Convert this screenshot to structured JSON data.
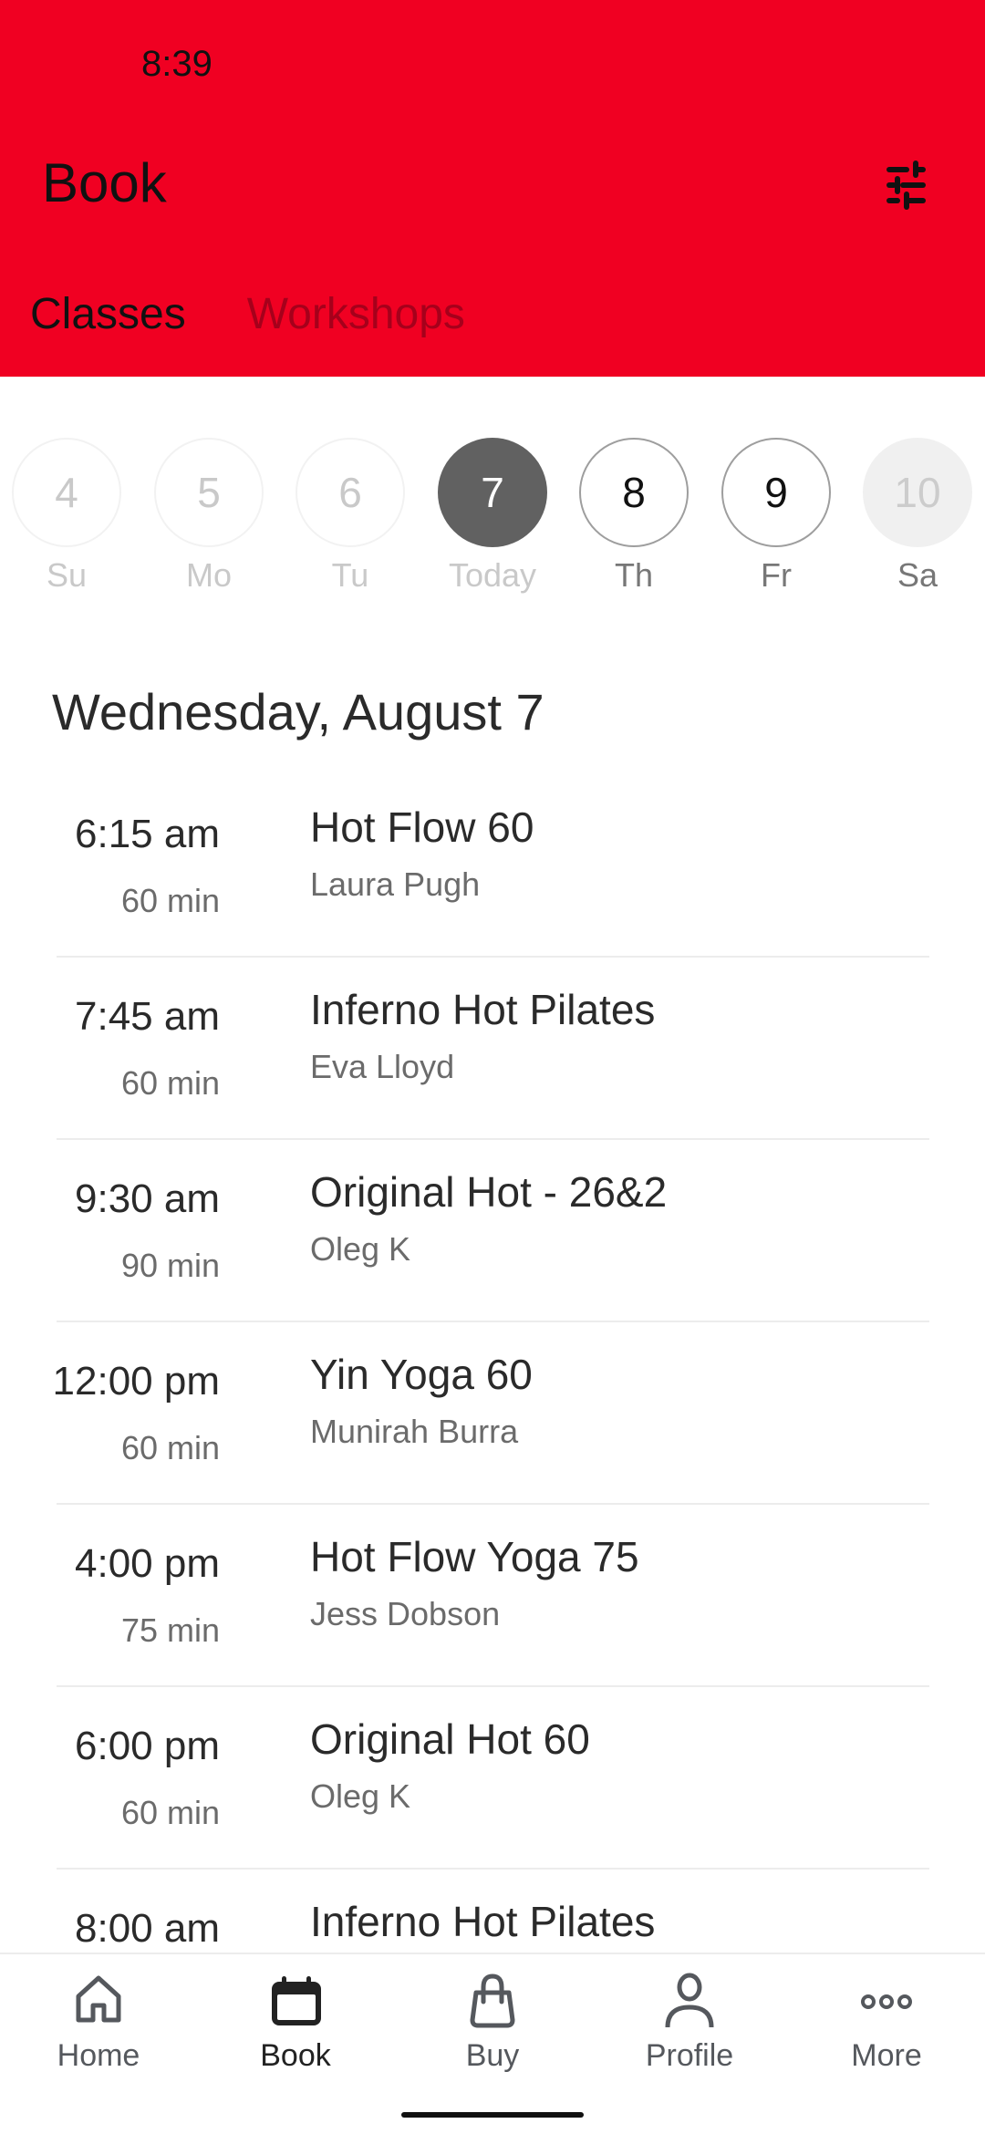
{
  "status_bar": {
    "time": "8:39"
  },
  "header": {
    "title": "Book",
    "filter_icon": "sliders-icon",
    "tabs": [
      {
        "label": "Classes",
        "active": true
      },
      {
        "label": "Workshops",
        "active": false
      }
    ]
  },
  "colors": {
    "brand": "#f00022",
    "inactive_tab": "#a6001b",
    "selected_day": "#616161"
  },
  "day_picker": {
    "days": [
      {
        "number": "4",
        "label": "Su",
        "state": "past"
      },
      {
        "number": "5",
        "label": "Mo",
        "state": "past"
      },
      {
        "number": "6",
        "label": "Tu",
        "state": "past"
      },
      {
        "number": "7",
        "label": "Today",
        "state": "selected"
      },
      {
        "number": "8",
        "label": "Th",
        "state": "available"
      },
      {
        "number": "9",
        "label": "Fr",
        "state": "available"
      },
      {
        "number": "10",
        "label": "Sa",
        "state": "unavailable"
      }
    ]
  },
  "schedule": {
    "date_heading": "Wednesday, August 7",
    "classes": [
      {
        "time": "6:15 am",
        "duration": "60 min",
        "name": "Hot Flow 60",
        "instructor": "Laura Pugh"
      },
      {
        "time": "7:45 am",
        "duration": "60 min",
        "name": "Inferno Hot Pilates",
        "instructor": "Eva Lloyd"
      },
      {
        "time": "9:30 am",
        "duration": "90 min",
        "name": "Original Hot - 26&2",
        "instructor": "Oleg K"
      },
      {
        "time": "12:00 pm",
        "duration": "60 min",
        "name": "Yin Yoga 60",
        "instructor": "Munirah Burra"
      },
      {
        "time": "4:00 pm",
        "duration": "75 min",
        "name": "Hot Flow Yoga 75",
        "instructor": "Jess Dobson"
      },
      {
        "time": "6:00 pm",
        "duration": "60 min",
        "name": "Original Hot 60",
        "instructor": "Oleg K"
      },
      {
        "time": "8:00 am",
        "duration": "",
        "name": "Inferno Hot Pilates",
        "instructor": ""
      }
    ]
  },
  "bottom_nav": {
    "items": [
      {
        "label": "Home",
        "icon": "home-icon",
        "active": false
      },
      {
        "label": "Book",
        "icon": "calendar-icon",
        "active": true
      },
      {
        "label": "Buy",
        "icon": "shopping-bag-icon",
        "active": false
      },
      {
        "label": "Profile",
        "icon": "person-icon",
        "active": false
      },
      {
        "label": "More",
        "icon": "more-dots-icon",
        "active": false
      }
    ]
  }
}
